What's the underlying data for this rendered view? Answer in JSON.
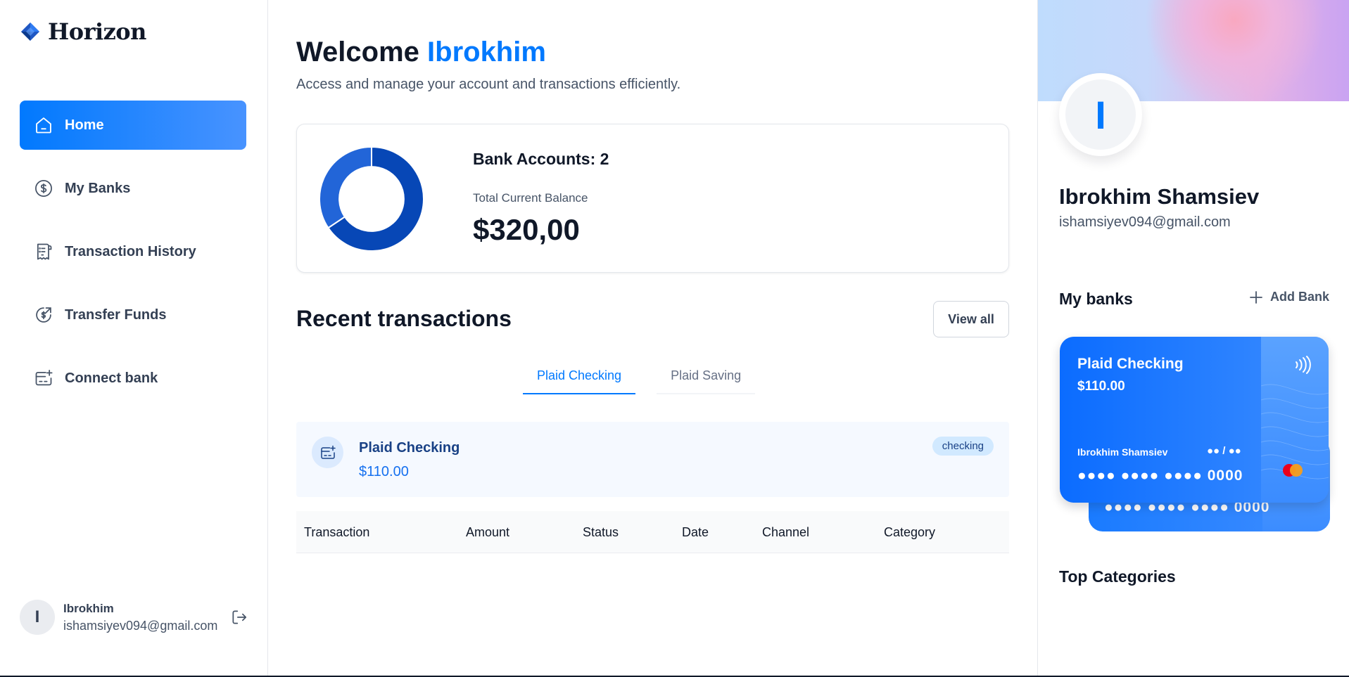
{
  "brand": {
    "name": "Horizon",
    "accent": "#0179FE"
  },
  "sidebar": {
    "items": [
      {
        "label": "Home",
        "icon": "home-icon",
        "active": true
      },
      {
        "label": "My Banks",
        "icon": "dollar-circle-icon",
        "active": false
      },
      {
        "label": "Transaction History",
        "icon": "receipt-icon",
        "active": false
      },
      {
        "label": "Transfer Funds",
        "icon": "money-send-icon",
        "active": false
      },
      {
        "label": "Connect bank",
        "icon": "card-add-icon",
        "active": false
      }
    ],
    "user": {
      "initial": "I",
      "name": "Ibrokhim",
      "email": "ishamsiyev094@gmail.com"
    }
  },
  "main": {
    "welcome_prefix": "Welcome",
    "welcome_name": "Ibrokhim",
    "subtitle": "Access and manage your account and transactions efficiently.",
    "balance": {
      "bank_accounts_label": "Bank Accounts: 2",
      "total_label": "Total Current Balance",
      "total_value": "$320,00"
    },
    "recent": {
      "title": "Recent transactions",
      "view_all": "View all",
      "tabs": [
        {
          "label": "Plaid Checking",
          "active": true
        },
        {
          "label": "Plaid Saving",
          "active": false
        }
      ],
      "account": {
        "name": "Plaid Checking",
        "balance": "$110.00",
        "badge": "checking"
      },
      "columns": [
        "Transaction",
        "Amount",
        "Status",
        "Date",
        "Channel",
        "Category"
      ]
    }
  },
  "right": {
    "profile": {
      "initial": "I",
      "name": "Ibrokhim Shamsiev",
      "email": "ishamsiyev094@gmail.com"
    },
    "my_banks_title": "My banks",
    "add_bank": "Add Bank",
    "card": {
      "name": "Plaid Checking",
      "balance": "$110.00",
      "holder": "Ibrokhim Shamsiev",
      "expiry": "●● / ●●",
      "number": "●●●● ●●●● ●●●● 0000"
    },
    "top_categories": "Top Categories"
  },
  "chart_data": {
    "type": "pie",
    "values": [
      210,
      110
    ],
    "colors": [
      "#0747b6",
      "#2265d8"
    ],
    "hole": 0.62
  }
}
